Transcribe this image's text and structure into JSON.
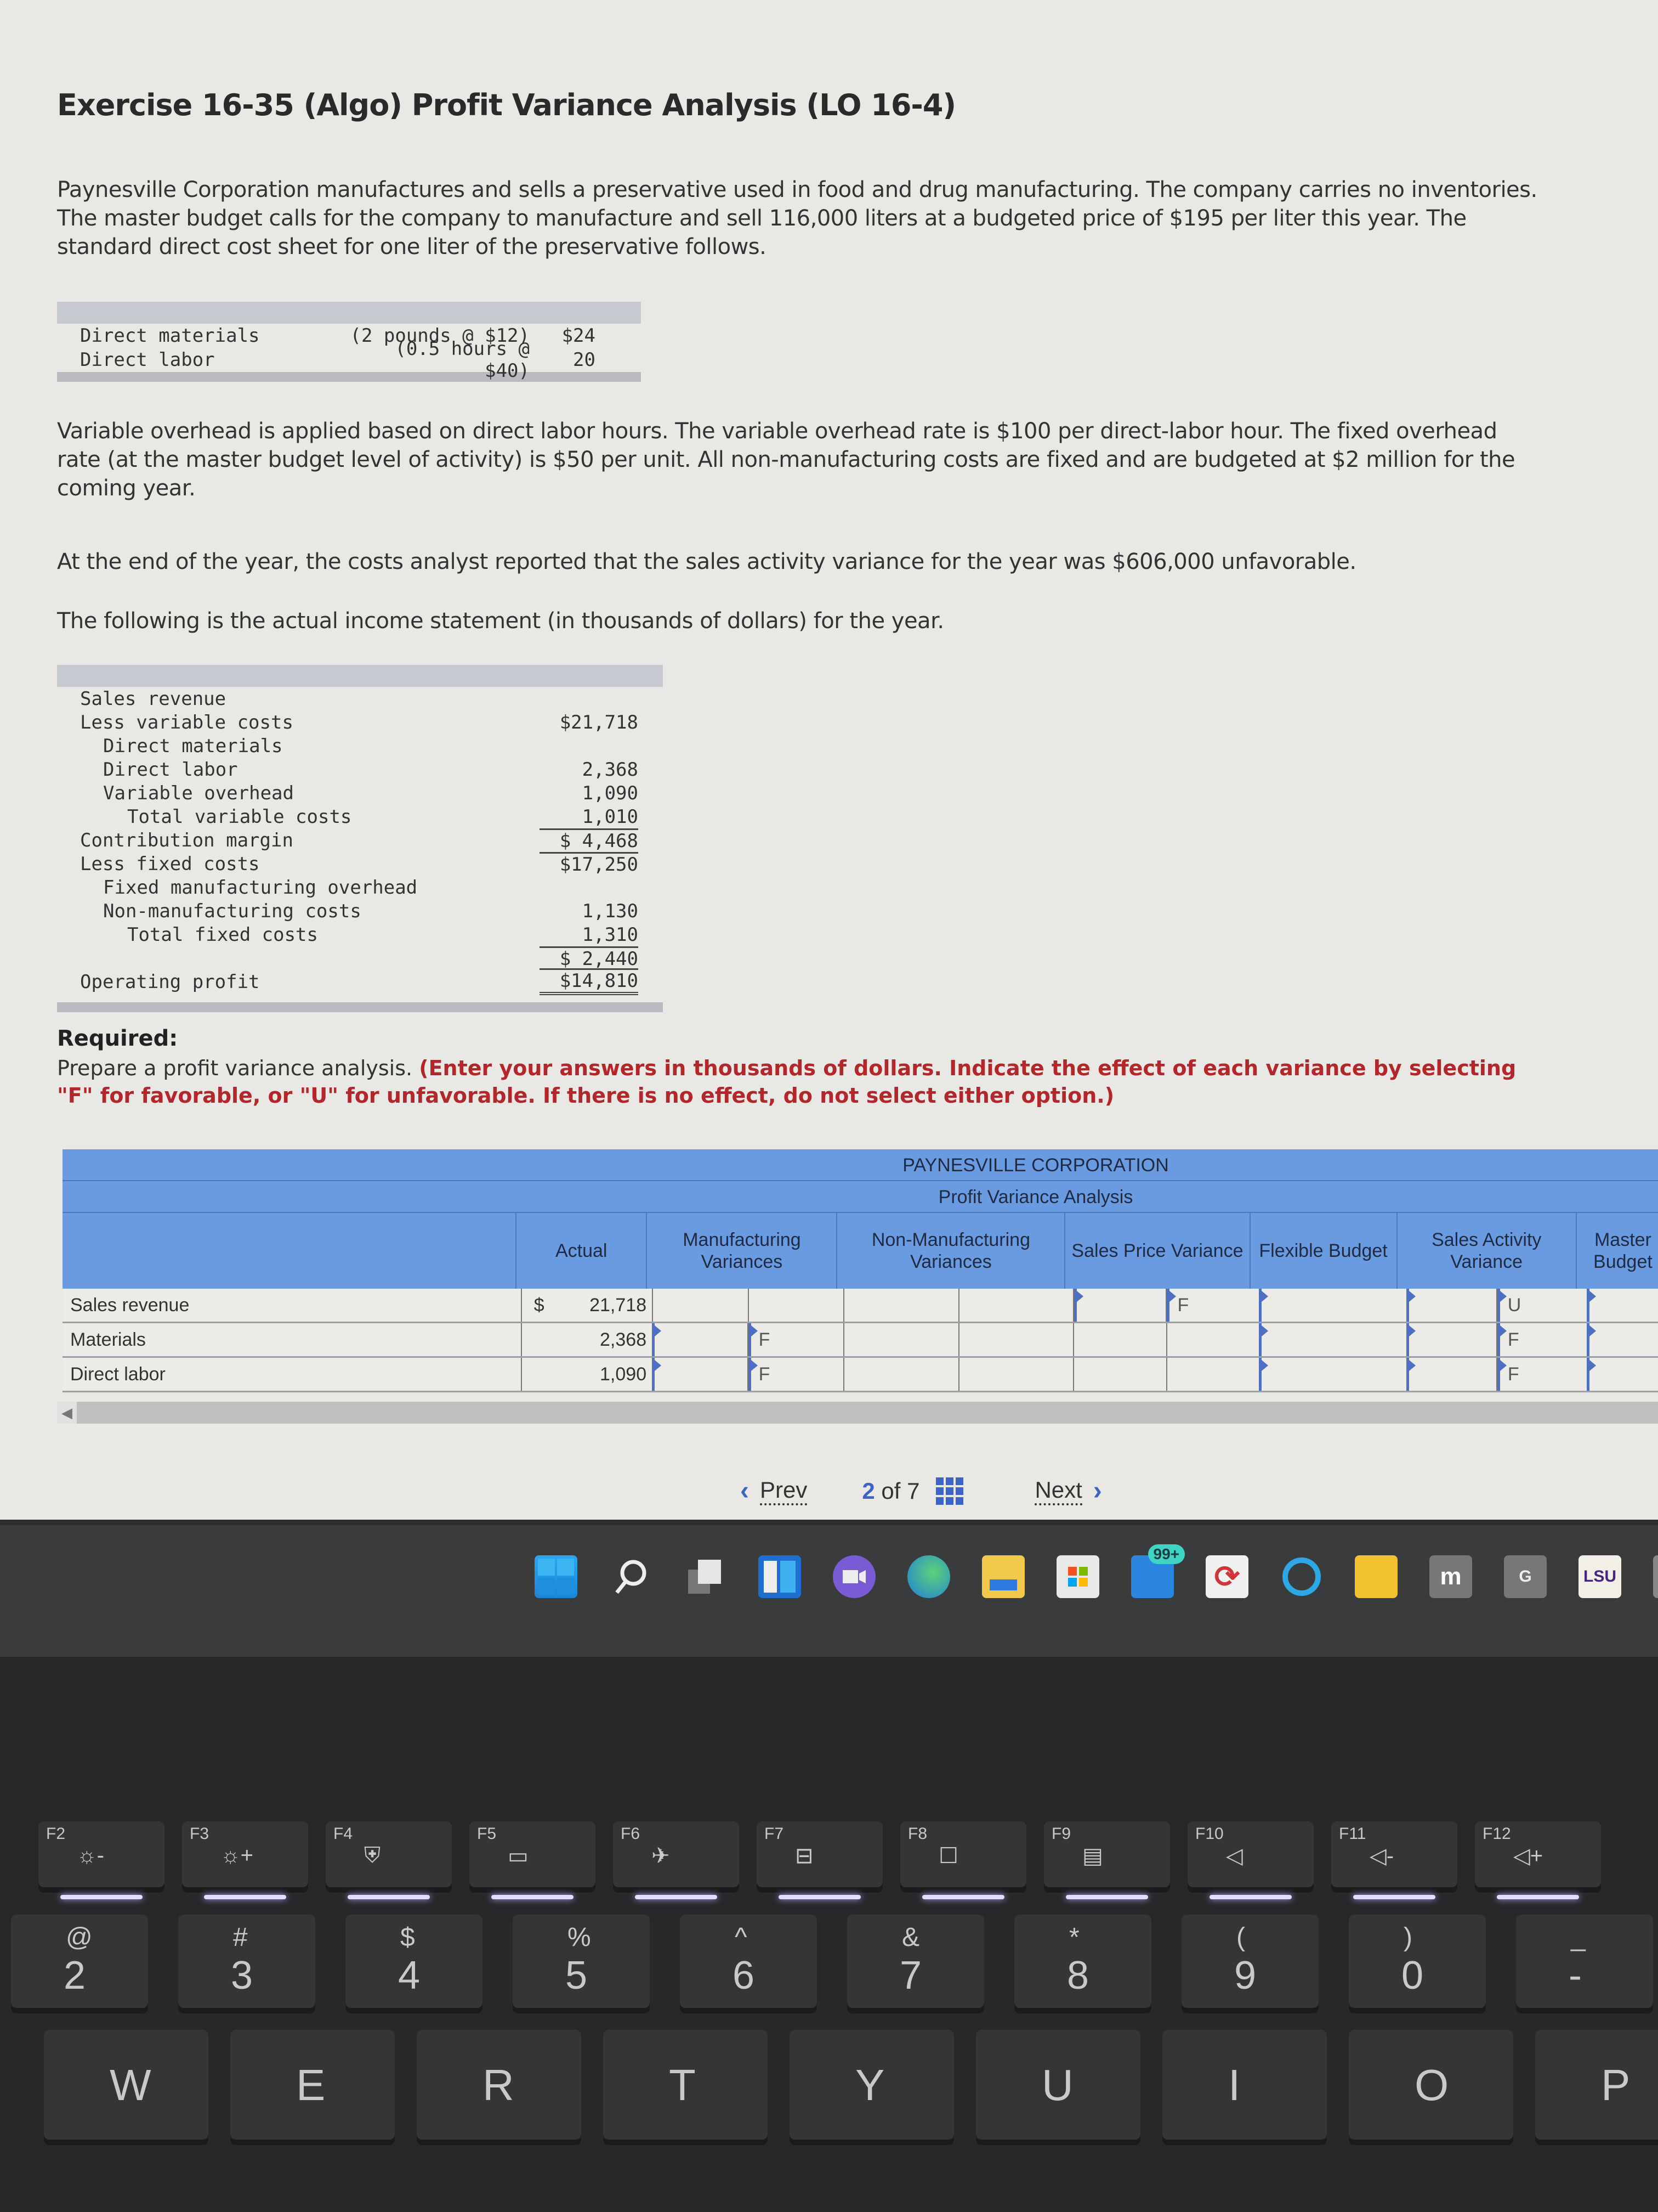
{
  "exercise": {
    "title": "Exercise 16-35 (Algo) Profit Variance Analysis (LO 16-4)",
    "intro": "Paynesville Corporation manufactures and sells a preservative used in food and drug manufacturing. The company carries no inventories. The master budget calls for the company to manufacture and sell 116,000 liters at a budgeted price of $195 per liter this year. The standard direct cost sheet for one liter of the preservative follows.",
    "cost_sheet": [
      {
        "label": "Direct materials",
        "qty": "(2 pounds @ $12)",
        "amount": "$24"
      },
      {
        "label": "Direct labor",
        "qty": "(0.5 hours @ $40)",
        "amount": "20"
      }
    ],
    "overhead_text": "Variable overhead is applied based on direct labor hours. The variable overhead rate is $100 per direct-labor hour. The fixed overhead rate (at the master budget level of activity) is $50 per unit. All non-manufacturing costs are fixed and are budgeted at $2 million for the coming year.",
    "sales_activity_text": "At the end of the year, the costs analyst reported that the sales activity variance for the year was $606,000 unfavorable.",
    "income_intro": "The following is the actual income statement (in thousands of dollars) for the year.",
    "income_statement": [
      {
        "label": "Sales revenue",
        "amount": "",
        "indent": 0
      },
      {
        "label": "Less variable costs",
        "amount": "$21,718",
        "indent": 0
      },
      {
        "label": "Direct materials",
        "amount": "",
        "indent": 1
      },
      {
        "label": "Direct labor",
        "amount": "2,368",
        "indent": 1
      },
      {
        "label": "Variable overhead",
        "amount": "1,090",
        "indent": 1
      },
      {
        "label": "Total variable costs",
        "amount": "1,010",
        "indent": 2
      },
      {
        "label": "Contribution margin",
        "amount": "$ 4,468",
        "indent": 0
      },
      {
        "label": "Less fixed costs",
        "amount": "$17,250",
        "indent": 0
      },
      {
        "label": "Fixed manufacturing overhead",
        "amount": "",
        "indent": 1
      },
      {
        "label": "Non-manufacturing costs",
        "amount": "1,130",
        "indent": 1
      },
      {
        "label": "Total fixed costs",
        "amount": "1,310",
        "indent": 2
      },
      {
        "label": "",
        "amount": "$ 2,440",
        "indent": 0
      },
      {
        "label": "Operating profit",
        "amount": "$14,810",
        "indent": 0
      }
    ],
    "required_label": "Required:",
    "required_text": "Prepare a profit variance analysis. ",
    "required_instruction": "(Enter your answers in thousands of dollars. Indicate the effect of each variance by selecting \"F\" for favorable, or \"U\" for unfavorable. If there is no effect, do not select either option.)"
  },
  "answer_table": {
    "company": "PAYNESVILLE CORPORATION",
    "subtitle": "Profit Variance Analysis",
    "columns": [
      "",
      "Actual",
      "Manufacturing Variances",
      "Non-Manufacturing Variances",
      "Sales Price Variance",
      "Flexible Budget",
      "Sales Activity Variance",
      "Master Budget"
    ],
    "rows": [
      {
        "label": "Sales revenue",
        "currency": "$",
        "actual": "21,718",
        "mfg_effect": "",
        "nonmfg_effect": "",
        "price_effect": "F",
        "activity_effect": "U"
      },
      {
        "label": "Materials",
        "currency": "",
        "actual": "2,368",
        "mfg_effect": "F",
        "nonmfg_effect": "",
        "price_effect": "",
        "activity_effect": "F"
      },
      {
        "label": "Direct labor",
        "currency": "",
        "actual": "1,090",
        "mfg_effect": "F",
        "nonmfg_effect": "",
        "price_effect": "",
        "activity_effect": "F"
      }
    ]
  },
  "navigation": {
    "prev_label": "Prev",
    "current_page": "2",
    "of_label": "of 7",
    "next_label": "Next"
  },
  "taskbar": {
    "icons": [
      "windows-start",
      "search",
      "task-view",
      "widgets",
      "teams-chat",
      "edge",
      "file-explorer",
      "microsoft-store",
      "mail",
      "sync-app",
      "cortana",
      "sticky-notes",
      "moodle",
      "google",
      "lsu",
      "other-app"
    ],
    "mail_badge": "99+",
    "lsu_label": "LSU",
    "google_label": "G",
    "moodle_label": "m"
  },
  "keyboard": {
    "function_keys": [
      {
        "label": "F2",
        "icon": "☼-"
      },
      {
        "label": "F3",
        "icon": "☼+"
      },
      {
        "label": "F4",
        "icon": "⛨"
      },
      {
        "label": "F5",
        "icon": "▭"
      },
      {
        "label": "F6",
        "icon": "✈"
      },
      {
        "label": "F7",
        "icon": "⊟"
      },
      {
        "label": "F8",
        "icon": "☐"
      },
      {
        "label": "F9",
        "icon": "▤"
      },
      {
        "label": "F10",
        "icon": "◁"
      },
      {
        "label": "F11",
        "icon": "◁-"
      },
      {
        "label": "F12",
        "icon": "◁+"
      }
    ],
    "number_keys": [
      {
        "sym": "@",
        "num": "2"
      },
      {
        "sym": "#",
        "num": "3"
      },
      {
        "sym": "$",
        "num": "4"
      },
      {
        "sym": "%",
        "num": "5"
      },
      {
        "sym": "^",
        "num": "6"
      },
      {
        "sym": "&",
        "num": "7"
      },
      {
        "sym": "*",
        "num": "8"
      },
      {
        "sym": "(",
        "num": "9"
      },
      {
        "sym": ")",
        "num": "0"
      },
      {
        "sym": "_",
        "num": "-"
      }
    ],
    "letter_keys": [
      "W",
      "E",
      "R",
      "T",
      "Y",
      "U",
      "I",
      "O",
      "P"
    ]
  }
}
